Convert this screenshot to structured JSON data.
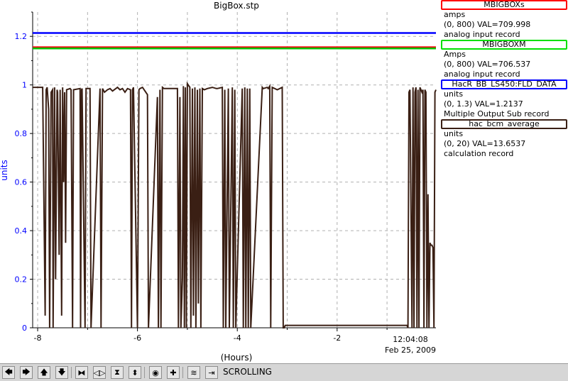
{
  "window": {
    "title": "BigBox.stp"
  },
  "chart_data": {
    "type": "line",
    "title": "BigBox.stp",
    "xlabel": "(Hours)",
    "ylabel": "units",
    "xlim": [
      -8.1,
      -0.02
    ],
    "ylim": [
      0,
      1.3
    ],
    "x_ticks": [
      -8,
      -6,
      -4,
      -2
    ],
    "x_tick_labels": [
      "-8",
      "-6",
      "-4",
      "-2"
    ],
    "y_ticks": [
      0,
      0.2,
      0.4,
      0.6,
      0.8,
      1,
      1.2
    ],
    "y_tick_labels": [
      "0",
      "0.2",
      "0.4",
      "0.6",
      "0.8",
      "1",
      "1.2"
    ],
    "grid": true,
    "time_label": "12:04:08",
    "date_label": "Feb 25, 2009",
    "series": [
      {
        "name": "MBIGBOXs",
        "color": "#ff0000",
        "x": [
          -8.1,
          -0.02
        ],
        "y": [
          1.155,
          1.155
        ]
      },
      {
        "name": "MBIGBOXM",
        "color": "#00c000",
        "x": [
          -8.1,
          -0.02
        ],
        "y": [
          1.15,
          1.15
        ]
      },
      {
        "name": "HacR_BB_LS450:FLD_DATA",
        "color": "#0000ff",
        "x": [
          -8.1,
          -0.02
        ],
        "y": [
          1.2137,
          1.2137
        ]
      },
      {
        "name": "hac_bcm_average",
        "color": "#3a1f14",
        "x": [
          -8.1,
          -7.9,
          -7.85,
          -7.83,
          -7.81,
          -7.78,
          -7.76,
          -7.73,
          -7.7,
          -7.69,
          -7.66,
          -7.64,
          -7.61,
          -7.6,
          -7.57,
          -7.55,
          -7.52,
          -7.5,
          -7.48,
          -7.46,
          -7.44,
          -7.42,
          -7.35,
          -7.33,
          -7.3,
          -7.28,
          -7.15,
          -7.14,
          -7.12,
          -7.11,
          -7.05,
          -7.03,
          -6.95,
          -6.93,
          -6.75,
          -6.73,
          -6.7,
          -6.66,
          -6.6,
          -6.55,
          -6.5,
          -6.4,
          -6.35,
          -6.3,
          -6.25,
          -6.2,
          -6.14,
          -6.12,
          -6.1,
          -6.08,
          -6.0,
          -5.97,
          -5.95,
          -5.9,
          -5.8,
          -5.78,
          -5.6,
          -5.58,
          -5.55,
          -5.53,
          -5.5,
          -5.47,
          -5.2,
          -5.18,
          -5.15,
          -5.13,
          -5.1,
          -5.08,
          -5.06,
          -5.04,
          -5.02,
          -5.0,
          -4.95,
          -4.93,
          -4.9,
          -4.88,
          -4.85,
          -4.83,
          -4.8,
          -4.78,
          -4.75,
          -4.73,
          -4.7,
          -4.66,
          -4.6,
          -4.5,
          -4.42,
          -4.4,
          -4.3,
          -4.28,
          -4.25,
          -4.23,
          -4.18,
          -4.16,
          -4.1,
          -4.08,
          -4.05,
          -4.03,
          -3.9,
          -3.88,
          -3.85,
          -3.83,
          -3.8,
          -3.78,
          -3.75,
          -3.73,
          -3.5,
          -3.48,
          -3.4,
          -3.38,
          -3.35,
          -3.33,
          -3.3,
          -3.2,
          -3.1,
          -3.08,
          -3.06,
          -3.04,
          -0.6,
          -0.58,
          -0.56,
          -0.54,
          -0.5,
          -0.48,
          -0.46,
          -0.44,
          -0.42,
          -0.4,
          -0.38,
          -0.36,
          -0.34,
          -0.3,
          -0.28,
          -0.26,
          -0.24,
          -0.22,
          -0.2,
          -0.18,
          -0.16,
          -0.14,
          -0.12,
          -0.1,
          -0.08,
          -0.06,
          -0.04,
          -0.02
        ],
        "y": [
          0.99,
          0.99,
          0.05,
          0.98,
          0.99,
          0.9,
          0.0,
          0.97,
          0.98,
          0.0,
          0.99,
          0.2,
          0.98,
          0.97,
          0.3,
          0.98,
          0.05,
          0.99,
          0.6,
          0.97,
          0.35,
          0.98,
          0.985,
          0.98,
          0.0,
          0.98,
          0.985,
          0.0,
          0.98,
          0.985,
          0.0,
          0.985,
          0.985,
          0.0,
          0.985,
          0.0,
          0.985,
          0.97,
          0.98,
          0.985,
          0.975,
          0.99,
          0.98,
          0.985,
          0.97,
          0.985,
          0.98,
          0.0,
          0.98,
          0.99,
          0.0,
          0.98,
          0.985,
          0.99,
          0.96,
          0.0,
          0.95,
          0.0,
          0.98,
          0.0,
          0.99,
          0.985,
          0.985,
          0.0,
          0.95,
          0.0,
          0.2,
          0.995,
          0.0,
          0.99,
          0.0,
          1.005,
          0.99,
          0.0,
          0.985,
          0.05,
          0.99,
          0.0,
          0.98,
          0.1,
          0.985,
          0.0,
          0.985,
          0.98,
          0.985,
          0.99,
          0.985,
          0.985,
          0.99,
          0.0,
          0.98,
          0.0,
          0.985,
          0.0,
          0.99,
          0.0,
          0.98,
          0.0,
          0.985,
          0.0,
          0.99,
          0.0,
          0.985,
          0.0,
          0.985,
          0.0,
          0.99,
          0.985,
          0.99,
          0.985,
          0.995,
          0.0,
          0.99,
          0.98,
          0.99,
          0.0,
          0.0,
          0.01,
          0.01,
          0.0,
          0.97,
          0.98,
          0.0,
          0.99,
          0.0,
          0.97,
          0.99,
          0.0,
          0.98,
          0.0,
          0.99,
          0.97,
          0.98,
          0.0,
          0.98,
          0.97,
          0.0,
          0.55,
          0.0,
          0.35,
          0.34,
          0.34,
          0.33,
          0.0,
          0.97,
          0.98
        ]
      }
    ]
  },
  "legend": [
    {
      "name": "MBIGBOXs",
      "color": "#ff0000",
      "units": "amps",
      "range": "(0, 800) VAL=709.998",
      "record": "analog input record"
    },
    {
      "name": "MBIGBOXM",
      "color": "#00e000",
      "units": "Amps",
      "range": "(0, 800) VAL=706.537",
      "record": "analog input record"
    },
    {
      "name": "HacR_BB_LS450:FLD_DATA",
      "color": "#0000ff",
      "units": "units",
      "range": "(0, 1.3) VAL=1.2137",
      "record": "Multiple Output Sub record"
    },
    {
      "name": "hac_bcm_average",
      "color": "#3a1f14",
      "units": "units",
      "range": "(0, 20) VAL=13.6537",
      "record": "calculation record"
    }
  ],
  "toolbar": {
    "mode_label": "SCROLLING",
    "buttons": [
      {
        "icon": "arrow-left-icon",
        "glyph": "🡄"
      },
      {
        "icon": "arrow-right-icon",
        "glyph": "🡆"
      },
      {
        "icon": "arrow-up-icon",
        "glyph": "🡅"
      },
      {
        "icon": "arrow-down-icon",
        "glyph": "🡇"
      },
      {
        "icon": "zoom-in-horizontal-icon",
        "glyph": "⧓"
      },
      {
        "icon": "zoom-out-horizontal-icon",
        "glyph": "◁▷"
      },
      {
        "icon": "zoom-in-vertical-icon",
        "glyph": "⧗"
      },
      {
        "icon": "zoom-out-vertical-icon",
        "glyph": "⬍"
      },
      {
        "icon": "autoscale-icon",
        "glyph": "◉"
      },
      {
        "icon": "crosshair-icon",
        "glyph": "✚"
      },
      {
        "icon": "scroll-mode-icon",
        "glyph": "≋"
      },
      {
        "icon": "go-to-end-icon",
        "glyph": "⇥"
      }
    ]
  },
  "colors": {
    "axis_y": "#0000ff",
    "grid": "#b0b0b0",
    "background": "#ffffff",
    "toolbar": "#d6d6d6"
  }
}
